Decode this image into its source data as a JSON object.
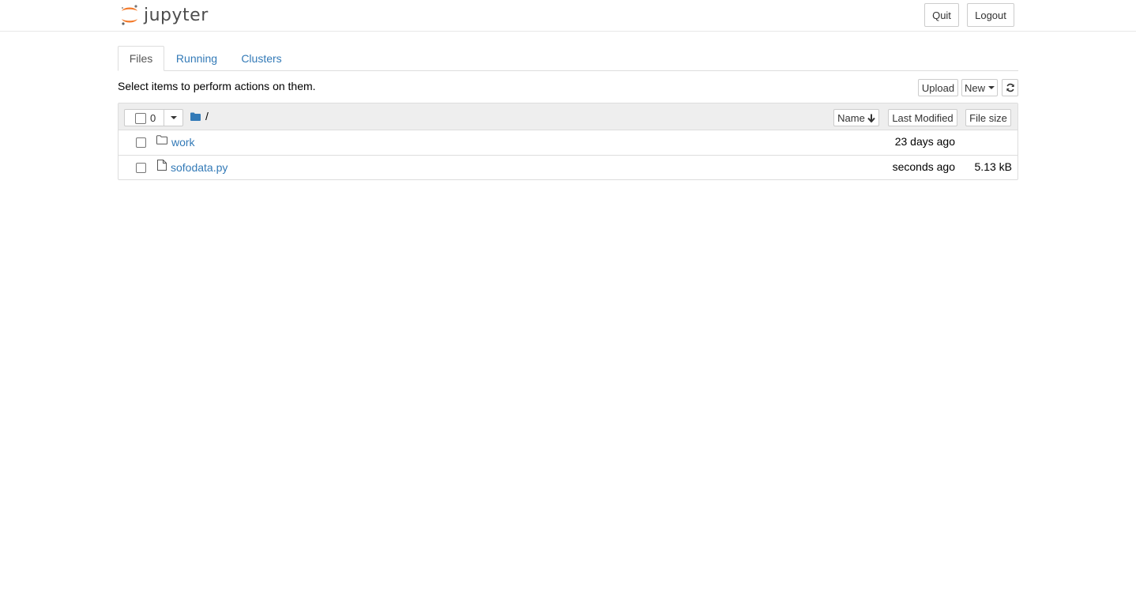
{
  "header": {
    "logo_text": "jupyter",
    "quit_label": "Quit",
    "logout_label": "Logout"
  },
  "tabs": [
    {
      "label": "Files",
      "active": true
    },
    {
      "label": "Running",
      "active": false
    },
    {
      "label": "Clusters",
      "active": false
    }
  ],
  "toolbar": {
    "hint": "Select items to perform actions on them.",
    "upload_label": "Upload",
    "new_label": "New",
    "refresh_icon": "refresh-icon"
  },
  "list_header": {
    "selected_count": "0",
    "breadcrumb": "/",
    "sort_name_label": "Name",
    "sort_modified_label": "Last Modified",
    "sort_size_label": "File size"
  },
  "files": [
    {
      "name": "work",
      "type": "folder",
      "modified": "23 days ago",
      "size": ""
    },
    {
      "name": "sofodata.py",
      "type": "file",
      "modified": "seconds ago",
      "size": "5.13 kB"
    }
  ],
  "colors": {
    "link": "#337ab7",
    "logo_orange": "#f37726",
    "border": "#dddddd",
    "header_bg": "#eeeeee"
  }
}
